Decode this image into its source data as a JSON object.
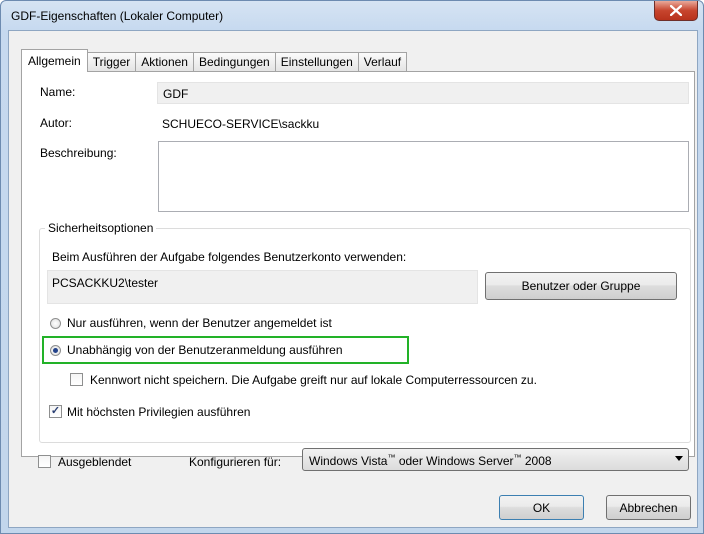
{
  "window": {
    "title": "GDF-Eigenschaften (Lokaler Computer)",
    "close_icon": "close-icon"
  },
  "tabs": [
    {
      "label": "Allgemein",
      "active": true
    },
    {
      "label": "Trigger"
    },
    {
      "label": "Aktionen"
    },
    {
      "label": "Bedingungen"
    },
    {
      "label": "Einstellungen"
    },
    {
      "label": "Verlauf"
    }
  ],
  "general": {
    "name_label": "Name:",
    "name_value": "GDF",
    "author_label": "Autor:",
    "author_value": "SCHUECO-SERVICE\\sackku",
    "description_label": "Beschreibung:",
    "description_value": ""
  },
  "security": {
    "group_title": "Sicherheitsoptionen",
    "account_prompt": "Beim Ausführen der Aufgabe folgendes Benutzerkonto verwenden:",
    "account_value": "PCSACKKU2\\tester",
    "change_user_button": "Benutzer oder Gruppe",
    "radio_logged_on": "Nur ausführen, wenn der Benutzer angemeldet ist",
    "radio_independent": "Unabhängig von der Benutzeranmeldung ausführen",
    "selected_radio": "independent",
    "no_password_label": "Kennwort nicht speichern. Die Aufgabe greift nur auf lokale Computerressourcen zu.",
    "no_password_checked": false,
    "highest_privileges_label": "Mit höchsten Privilegien ausführen",
    "highest_privileges_checked": true
  },
  "footer": {
    "hidden_label": "Ausgeblendet",
    "hidden_checked": false,
    "configure_label": "Konfigurieren für:",
    "configure_value_part1": "Windows Vista",
    "configure_tm": "™",
    "configure_value_part2": " oder Windows Server",
    "configure_value_part3": " 2008",
    "ok_button": "OK",
    "cancel_button": "Abbrechen"
  },
  "colors": {
    "highlight_border": "#22b228",
    "close_button": "#c7452e",
    "title_bar": "#c6d9ef"
  }
}
